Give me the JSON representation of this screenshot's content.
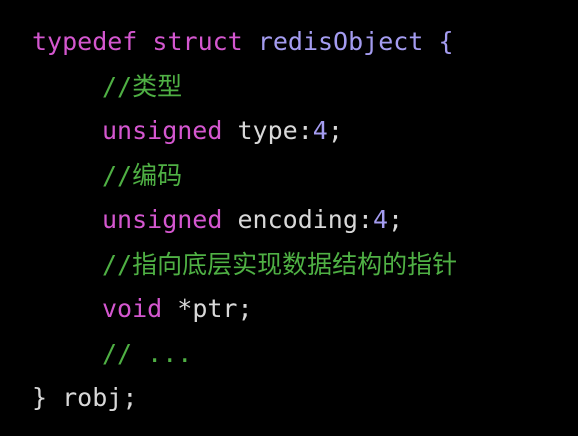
{
  "colors": {
    "background": "#000000",
    "keyword": "#d457cf",
    "type_name": "#a49cf0",
    "comment": "#4fb044",
    "plain": "#d8d8d8",
    "number": "#a49cf0"
  },
  "code": {
    "line1": {
      "kw_typedef": "typedef",
      "kw_struct": "struct",
      "name": "redisObject",
      "brace_open": "{"
    },
    "line2": {
      "comment": "//类型"
    },
    "line3": {
      "kw_unsigned": "unsigned",
      "field": "type",
      "colon": ":",
      "bits": "4",
      "semi": ";"
    },
    "line4": {
      "comment": "//编码"
    },
    "line5": {
      "kw_unsigned": "unsigned",
      "field": "encoding",
      "colon": ":",
      "bits": "4",
      "semi": ";"
    },
    "line6": {
      "comment": "//指向底层实现数据结构的指针"
    },
    "line7": {
      "kw_void": "void",
      "field": "*ptr",
      "semi": ";"
    },
    "line8": {
      "comment": "// ..."
    },
    "line9": {
      "brace_close": "}",
      "alias": "robj",
      "semi": ";"
    }
  }
}
